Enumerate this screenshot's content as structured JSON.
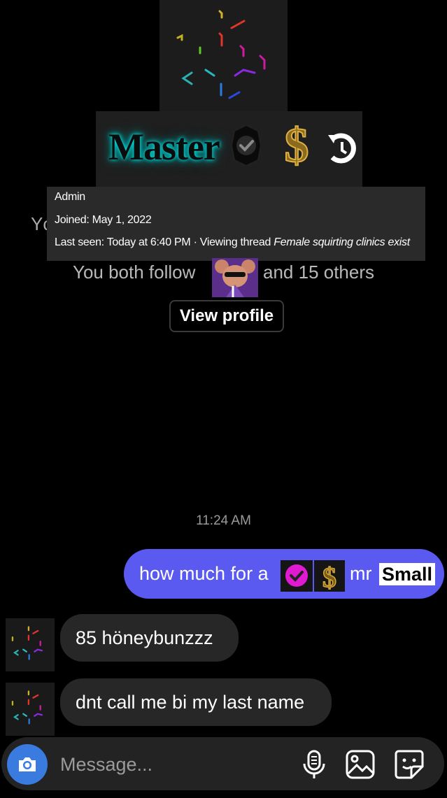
{
  "header": {
    "banner_title": "Master",
    "behind_text": "Yc"
  },
  "tooltip": {
    "role": "Admin",
    "joined_label": "Joined:",
    "joined_value": "May 1, 2022",
    "last_seen_label": "Last seen:",
    "last_seen_value": "Today at 6:40 PM · Viewing thread",
    "thread_title": "Female squirting clinics exist"
  },
  "profile": {
    "follow_prefix": "You both follow",
    "follow_suffix": "and 15 others",
    "view_profile_label": "View profile"
  },
  "conversation": {
    "timestamp": "11:24 AM",
    "sent_message": {
      "text_before": "how much for a",
      "text_after": "mr",
      "highlighted_word": "Small"
    },
    "received": [
      {
        "text": "85 höneybunzzz"
      },
      {
        "text": "dnt call me bi my last name"
      }
    ]
  },
  "composer": {
    "placeholder": "Message...",
    "icons": [
      "camera-icon",
      "microphone-icon",
      "gallery-icon",
      "sticker-icon"
    ]
  },
  "colors": {
    "sent_bubble": "#5b5af0",
    "received_bubble": "#272727",
    "camera_button": "#3a7be0",
    "badge_check": "#e01ad0"
  }
}
